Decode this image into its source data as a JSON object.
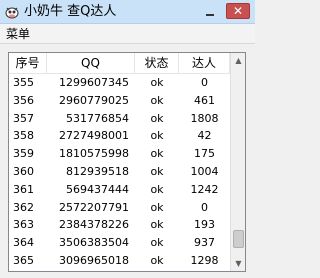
{
  "window": {
    "title": "小奶牛 查Q达人",
    "close_glyph": "✕"
  },
  "menu": {
    "label": "菜单"
  },
  "table": {
    "headers": [
      "序号",
      "QQ",
      "状态",
      "达人"
    ],
    "rows": [
      [
        "355",
        "1299607345",
        "ok",
        "0"
      ],
      [
        "356",
        "2960779025",
        "ok",
        "461"
      ],
      [
        "357",
        "531776854",
        "ok",
        "1808"
      ],
      [
        "358",
        "2727498001",
        "ok",
        "42"
      ],
      [
        "359",
        "1810575998",
        "ok",
        "175"
      ],
      [
        "360",
        "812939518",
        "ok",
        "1004"
      ],
      [
        "361",
        "569437444",
        "ok",
        "1242"
      ],
      [
        "362",
        "2572207791",
        "ok",
        "0"
      ],
      [
        "363",
        "2384378226",
        "ok",
        "193"
      ],
      [
        "364",
        "3506383504",
        "ok",
        "937"
      ],
      [
        "365",
        "3096965018",
        "ok",
        "1298"
      ]
    ]
  },
  "scrollbar": {
    "up_glyph": "▲",
    "down_glyph": "▼",
    "position_fraction": 0.95
  },
  "colors": {
    "titlebar": "#c9e2f7",
    "close_button": "#c75050"
  },
  "icons": {
    "app": "cow-icon",
    "minimize": "minimize-icon",
    "close": "close-icon"
  }
}
